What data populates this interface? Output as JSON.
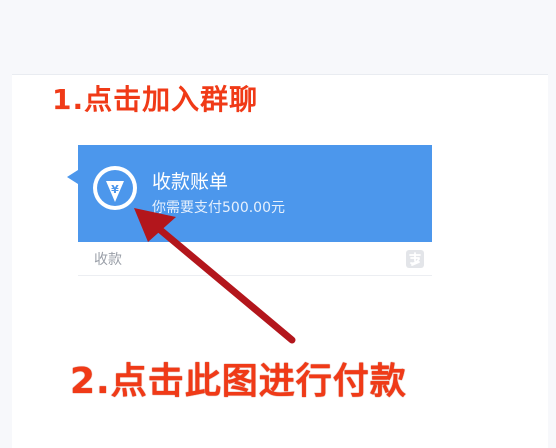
{
  "annotations": {
    "step1": "1.点击加入群聊",
    "step2": "2.点击此图进行付款"
  },
  "payment_card": {
    "title": "收款账单",
    "subtitle": "你需要支付500.00元",
    "footer_label": "收款",
    "icon": "yuan-download-icon",
    "brand_icon": "alipay-icon"
  },
  "colors": {
    "card_blue": "#4c97ec",
    "annotation_red": "#f03a17",
    "arrow_red": "#b3161c"
  }
}
